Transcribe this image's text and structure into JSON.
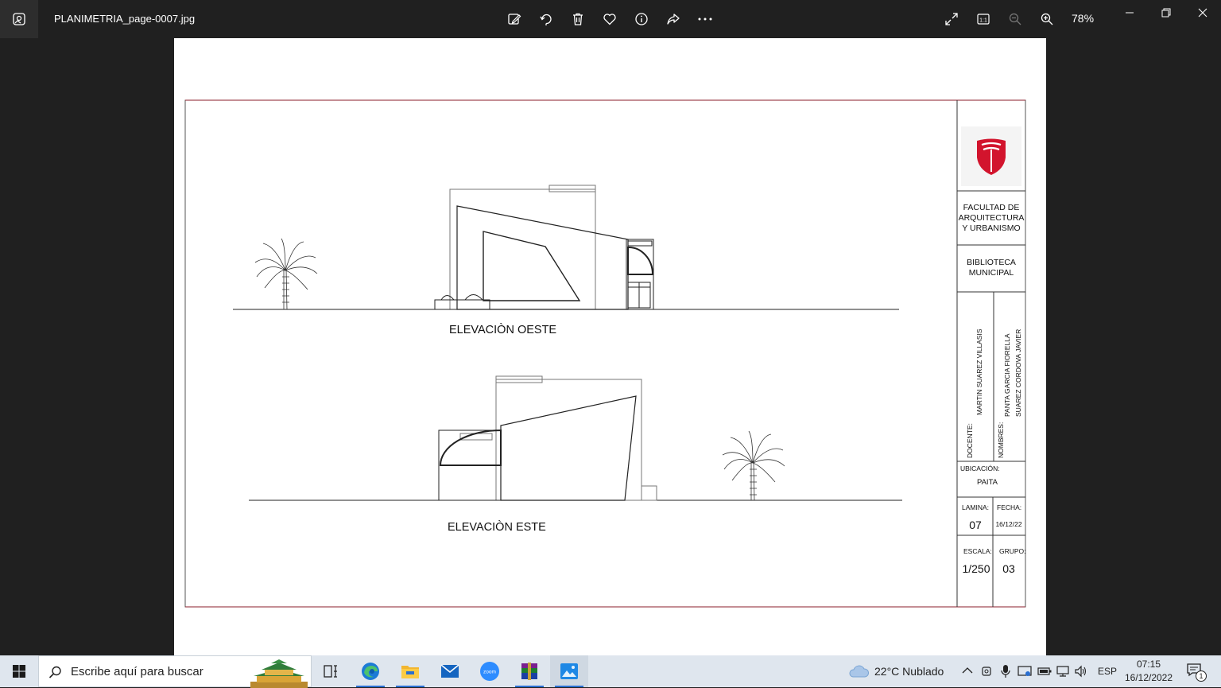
{
  "window": {
    "filename": "PLANIMETRIA_page-0007.jpg",
    "zoom": "78%"
  },
  "toolbar": {
    "icons": [
      "edit-image-icon",
      "rotate-icon",
      "delete-icon",
      "favorite-icon",
      "info-icon",
      "share-icon",
      "more-icon"
    ],
    "right_icons": [
      "fullscreen-icon",
      "actual-size-icon",
      "zoom-out-icon",
      "zoom-in-icon"
    ]
  },
  "drawing": {
    "west_label": "ELEVACIÒN OESTE",
    "east_label": "ELEVACIÒN ESTE",
    "title_block": {
      "faculty": [
        "FACULTAD DE",
        "ARQUITECTURA",
        "Y URBANISMO"
      ],
      "project": [
        "BIBLIOTECA",
        "MUNICIPAL"
      ],
      "docente_label": "DOCENTE:",
      "docente_name": "MARTIN SUAREZ VILLASIS",
      "nombres_label": "NOMBRES:",
      "nombres_1": "PANTA GARCIA FIORELLA",
      "nombres_2": "SUAREZ CORDOVA JAVIER",
      "ubicacion_label": "UBICACIÓN:",
      "ubicacion": "PAITA",
      "lamina_label": "LAMINA:",
      "lamina": "07",
      "fecha_label": "FECHA:",
      "fecha": "16/12/22",
      "escala_label": "ESCALA:",
      "escala": "1/250",
      "grupo_label": "GRUPO:",
      "grupo": "03"
    }
  },
  "taskbar": {
    "search_placeholder": "Escribe aquí para buscar",
    "weather": "22°C  Nublado",
    "language": "ESP",
    "time": "07:15",
    "date": "16/12/2022",
    "notification_count": "1",
    "colors": {
      "accent": "#2a6fd1",
      "logo_red": "#d2142d"
    }
  }
}
